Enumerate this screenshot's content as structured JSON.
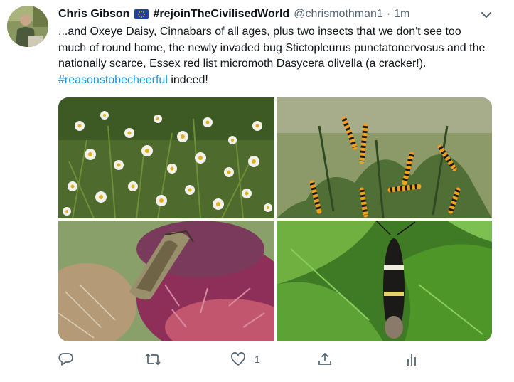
{
  "tweet": {
    "author_name": "Chris Gibson",
    "flag_icon": "eu-flag-icon",
    "display_tag": "#rejoinTheCivilisedWorld",
    "handle": "@chrismothman1",
    "separator": "·",
    "time": "1m",
    "text_main": "...and Oxeye Daisy, Cinnabars of all ages, plus two insects that we don't see too much of round home, the newly invaded bug Stictopleurus punctatonervosus and the nationally scarce, Essex red list micromoth Dasycera olivella (a cracker!). ",
    "hashtag": "#reasonstobecheerful",
    "text_end": " indeed!"
  },
  "media": {
    "photos": [
      "oxeye-daisy-photo",
      "cinnabar-caterpillars-photo",
      "stictopleurus-bug-photo",
      "dasycera-olivella-moth-photo"
    ]
  },
  "actions": {
    "reply_icon": "reply-icon",
    "retweet_icon": "retweet-icon",
    "like_icon": "heart-icon",
    "like_count": "1",
    "share_icon": "share-icon",
    "analytics_icon": "analytics-icon"
  },
  "colors": {
    "link": "#1b95e0",
    "text": "#0f1419",
    "muted": "#536471"
  }
}
